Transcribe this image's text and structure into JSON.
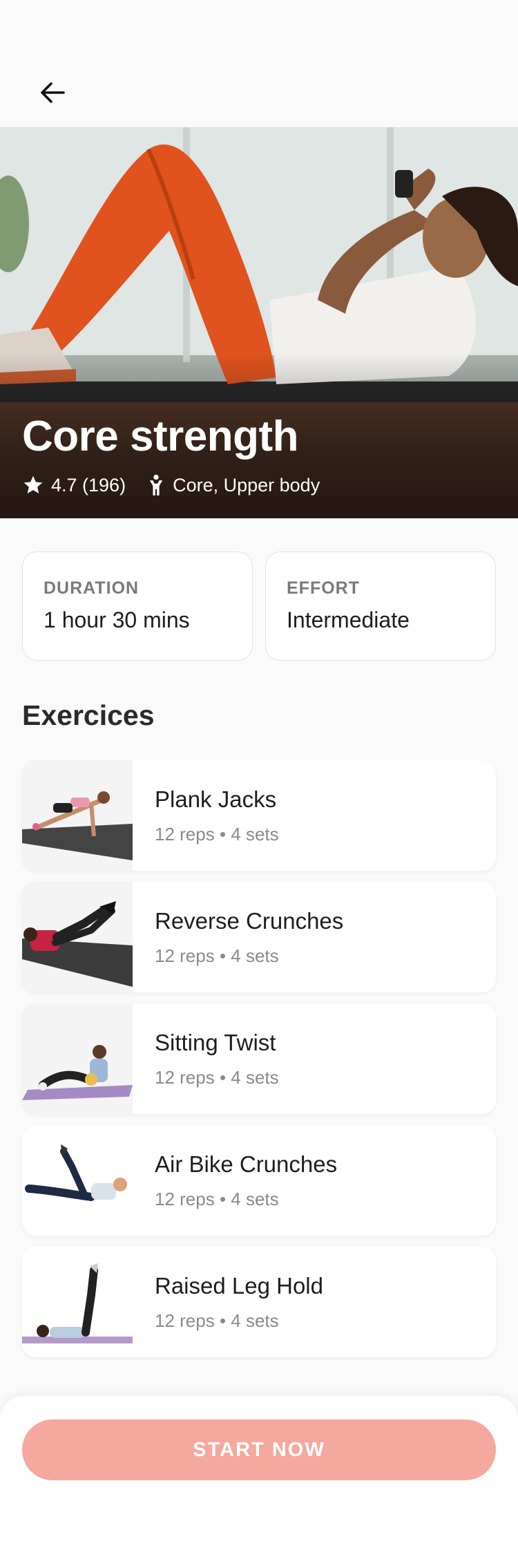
{
  "header": {
    "back_icon": "arrow-left-icon"
  },
  "hero": {
    "title": "Core strength",
    "rating_icon": "star-icon",
    "rating_text": "4.7 (196)",
    "body_icon": "person-icon",
    "body_text": "Core, Upper body"
  },
  "stats": [
    {
      "label": "DURATION",
      "value": "1 hour 30 mins"
    },
    {
      "label": "EFFORT",
      "value": "Intermediate"
    }
  ],
  "exercises_title": "Exercices",
  "exercises": [
    {
      "name": "Plank Jacks",
      "detail": "12 reps • 4 sets",
      "mat_color": "#444444",
      "accent": "#e99ab0"
    },
    {
      "name": "Reverse Crunches",
      "detail": "12 reps • 4 sets",
      "mat_color": "#3c3c3c",
      "accent": "#c62244"
    },
    {
      "name": "Sitting Twist",
      "detail": "12 reps • 4 sets",
      "mat_color": "#a58bc6",
      "accent": "#9fb7d6"
    },
    {
      "name": "Air Bike Crunches",
      "detail": "12 reps • 4 sets",
      "mat_color": "#ffffff",
      "accent": "#d9e1ea"
    },
    {
      "name": "Raised Leg Hold",
      "detail": "12 reps • 4 sets",
      "mat_color": "#b49ac9",
      "accent": "#b8cde0"
    }
  ],
  "cta": {
    "label": "START NOW",
    "color": "#f5a89d"
  }
}
